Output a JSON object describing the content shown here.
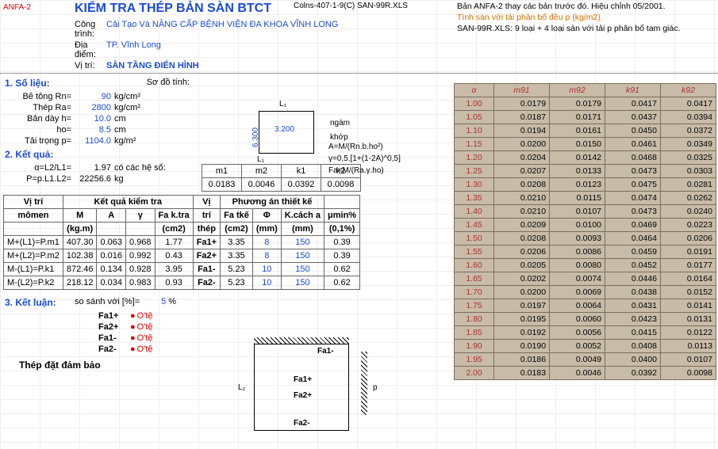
{
  "header": {
    "anfa": "ANFA-2",
    "title": "KIỂM TRA THÉP BẢN SÀN BTCT",
    "file": "Colns-407-1-9(C) SAN-99R.XLS",
    "note1": "Bản ANFA-2 thay các bản trước đó. Hiệu chỉnh 05/2001.",
    "note2": "Tính sàn với tải phân bố đều p (kg/m2).",
    "note3": "SAN-99R.XLS: 9 loại + 4 loại sàn với tải p phân bố tam giác."
  },
  "info": {
    "congtrinh_l": "Công trình:",
    "congtrinh_v": "Cải Tạo Và NÂNG CẤP BỆNH VIỆN ĐA KHOA VĨNH LONG",
    "diadiem_l": "Địa điểm:",
    "diadiem_v": "TP. Vĩnh Long",
    "vitri_l": "Vị trí:",
    "vitri_v": "SÀN TẦNG ĐIỂN HÌNH"
  },
  "s1": {
    "h": "1. Số liệu:",
    "sodo": "Sơ đồ tính:",
    "rows": [
      {
        "l": "Bê tông Rn=",
        "v": "90",
        "u": "kg/cm²"
      },
      {
        "l": "Thép Ra=",
        "v": "2800",
        "u": "kg/cm²"
      },
      {
        "l": "Bản dày h=",
        "v": "10.0",
        "u": "cm"
      },
      {
        "l": "ho=",
        "v": "8.5",
        "u": "cm"
      },
      {
        "l": "Tải trọng p=",
        "v": "1104.0",
        "u": "kg/m²"
      }
    ]
  },
  "diagram": {
    "L1": "L₁",
    "L1v": "3.200",
    "v630": "6.300",
    "Lb": "L₁",
    "ngam": "ngàm",
    "khop": "khớp",
    "f1": "A=M/(Rn.b.ho²)",
    "f2": "γ=0,5.[1+(1-2A)^0,5]",
    "f3": "Fa=M/(Ra.γ.ho)"
  },
  "s2": {
    "h": "2. Kết quả:",
    "alpha_l": "α=L2/L1=",
    "alpha_v": "1.97",
    "alpha_t": "có các hệ số:",
    "P_l": "P=p.L1.L2=",
    "P_v": "22256.6",
    "P_u": "kg",
    "coef_h": [
      "m1",
      "m2",
      "k1",
      "k2"
    ],
    "coef_v": [
      "0.0183",
      "0.0046",
      "0.0392",
      "0.0098"
    ]
  },
  "kq": {
    "head1": [
      "Vị trí",
      "Kết quả kiểm tra",
      "Vị",
      "Phương án thiết kế",
      ""
    ],
    "head2": [
      "mômen",
      "M",
      "A",
      "γ",
      "Fa k.tra",
      "trí",
      "Fa tkế",
      "Φ",
      "K.cách a",
      "μmin%"
    ],
    "head3": [
      "",
      "(kg.m)",
      "",
      "",
      "(cm2)",
      "thép",
      "(cm2)",
      "(mm)",
      "(mm)",
      "(0,1%)"
    ],
    "rows": [
      {
        "c": [
          "M+(L1)=P.m1",
          "407.30",
          "0.063",
          "0.968",
          "1.77",
          "Fa1+",
          "3.35",
          "8",
          "150",
          "0.39"
        ]
      },
      {
        "c": [
          "M+(L2)=P.m2",
          "102.38",
          "0.016",
          "0.992",
          "0.43",
          "Fa2+",
          "3.35",
          "8",
          "150",
          "0.39"
        ]
      },
      {
        "c": [
          "M-(L1)=P.k1",
          "872.46",
          "0.134",
          "0.928",
          "3.95",
          "Fa1-",
          "5.23",
          "10",
          "150",
          "0.62"
        ]
      },
      {
        "c": [
          "M-(L2)=P.k2",
          "218.12",
          "0.034",
          "0.983",
          "0.93",
          "Fa2-",
          "5.23",
          "10",
          "150",
          "0.62"
        ]
      }
    ]
  },
  "s3": {
    "h": "3. Kết luận:",
    "cmp_l": "so sánh với [%]=",
    "cmp_v": "5",
    "cmp_u": "%",
    "rows": [
      {
        "f": "Fa1+",
        "o": "O'tệ"
      },
      {
        "f": "Fa2+",
        "o": "O'tệ"
      },
      {
        "f": "Fa1-",
        "o": "O'tệ"
      },
      {
        "f": "Fa2-",
        "o": "O'tệ"
      }
    ],
    "footer": "Thép đặt đảm bảo"
  },
  "bd": {
    "L2": "L₂",
    "p": "p",
    "f1p": "Fa1+",
    "f1m": "Fa1-",
    "f2p": "Fa2+",
    "f2m": "Fa2-"
  },
  "alpha": {
    "head": [
      "α",
      "m91",
      "m92",
      "k91",
      "k92"
    ],
    "rows": [
      [
        "1.00",
        "0.0179",
        "0.0179",
        "0.0417",
        "0.0417"
      ],
      [
        "1.05",
        "0.0187",
        "0.0171",
        "0.0437",
        "0.0394"
      ],
      [
        "1.10",
        "0.0194",
        "0.0161",
        "0.0450",
        "0.0372"
      ],
      [
        "1.15",
        "0.0200",
        "0.0150",
        "0.0461",
        "0.0349"
      ],
      [
        "1.20",
        "0.0204",
        "0.0142",
        "0.0468",
        "0.0325"
      ],
      [
        "1.25",
        "0.0207",
        "0.0133",
        "0.0473",
        "0.0303"
      ],
      [
        "1.30",
        "0.0208",
        "0.0123",
        "0.0475",
        "0.0281"
      ],
      [
        "1.35",
        "0.0210",
        "0.0115",
        "0.0474",
        "0.0262"
      ],
      [
        "1.40",
        "0.0210",
        "0.0107",
        "0.0473",
        "0.0240"
      ],
      [
        "1.45",
        "0.0209",
        "0.0100",
        "0.0469",
        "0.0223"
      ],
      [
        "1.50",
        "0.0208",
        "0.0093",
        "0.0464",
        "0.0206"
      ],
      [
        "1.55",
        "0.0206",
        "0.0086",
        "0.0459",
        "0.0191"
      ],
      [
        "1.60",
        "0.0205",
        "0.0080",
        "0.0452",
        "0.0177"
      ],
      [
        "1.65",
        "0.0202",
        "0.0074",
        "0.0446",
        "0.0164"
      ],
      [
        "1.70",
        "0.0200",
        "0.0069",
        "0.0438",
        "0.0152"
      ],
      [
        "1.75",
        "0.0197",
        "0.0064",
        "0.0431",
        "0.0141"
      ],
      [
        "1.80",
        "0.0195",
        "0.0060",
        "0.0423",
        "0.0131"
      ],
      [
        "1.85",
        "0.0192",
        "0.0056",
        "0.0415",
        "0.0122"
      ],
      [
        "1.90",
        "0.0190",
        "0.0052",
        "0.0408",
        "0.0113"
      ],
      [
        "1.95",
        "0.0186",
        "0.0049",
        "0.0400",
        "0.0107"
      ],
      [
        "2.00",
        "0.0183",
        "0.0046",
        "0.0392",
        "0.0098"
      ]
    ]
  }
}
